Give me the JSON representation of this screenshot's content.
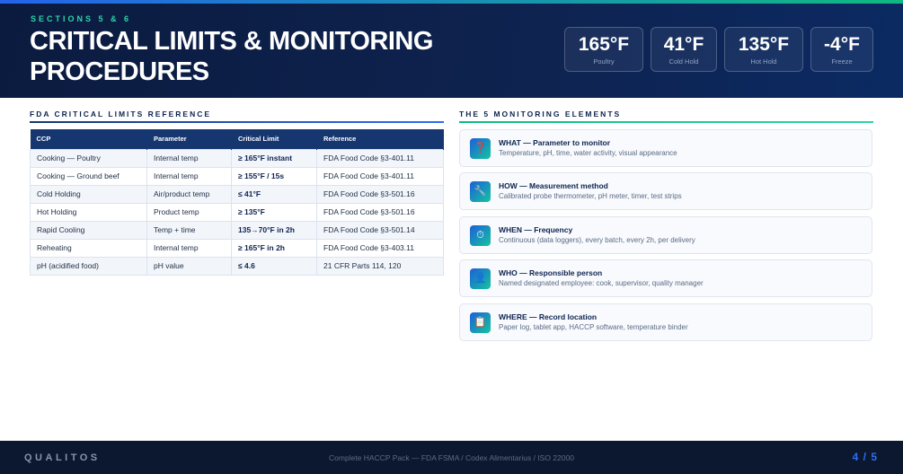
{
  "header": {
    "eyebrow": "SECTIONS 5 & 6",
    "title": "CRITICAL LIMITS & MONITORING PROCEDURES",
    "stats": [
      {
        "value": "165°F",
        "label": "Poultry"
      },
      {
        "value": "41°F",
        "label": "Cold Hold"
      },
      {
        "value": "135°F",
        "label": "Hot Hold"
      },
      {
        "value": "-4°F",
        "label": "Freeze"
      }
    ]
  },
  "limits_section": {
    "title": "FDA CRITICAL LIMITS REFERENCE",
    "columns": [
      "CCP",
      "Parameter",
      "Critical Limit",
      "Reference"
    ],
    "rows": [
      [
        "Cooking — Poultry",
        "Internal temp",
        "≥ 165°F instant",
        "FDA Food Code §3-401.11"
      ],
      [
        "Cooking — Ground beef",
        "Internal temp",
        "≥ 155°F / 15s",
        "FDA Food Code §3-401.11"
      ],
      [
        "Cold Holding",
        "Air/product temp",
        "≤ 41°F",
        "FDA Food Code §3-501.16"
      ],
      [
        "Hot Holding",
        "Product temp",
        "≥ 135°F",
        "FDA Food Code §3-501.16"
      ],
      [
        "Rapid Cooling",
        "Temp + time",
        "135→70°F in 2h",
        "FDA Food Code §3-501.14"
      ],
      [
        "Reheating",
        "Internal temp",
        "≥ 165°F in 2h",
        "FDA Food Code §3-403.11"
      ],
      [
        "pH (acidified food)",
        "pH value",
        "≤ 4.6",
        "21 CFR Parts 114, 120"
      ]
    ]
  },
  "monitoring_section": {
    "title": "THE 5 MONITORING ELEMENTS",
    "items": [
      {
        "icon": "❓",
        "icon_name": "question-icon",
        "title": "WHAT — Parameter to monitor",
        "desc": "Temperature, pH, time, water activity, visual appearance"
      },
      {
        "icon": "🔧",
        "icon_name": "wrench-icon",
        "title": "HOW — Measurement method",
        "desc": "Calibrated probe thermometer, pH meter, timer, test strips"
      },
      {
        "icon": "⏱",
        "icon_name": "timer-icon",
        "title": "WHEN — Frequency",
        "desc": "Continuous (data loggers), every batch, every 2h, per delivery"
      },
      {
        "icon": "👤",
        "icon_name": "person-icon",
        "title": "WHO — Responsible person",
        "desc": "Named designated employee: cook, supervisor, quality manager"
      },
      {
        "icon": "📋",
        "icon_name": "clipboard-icon",
        "title": "WHERE — Record location",
        "desc": "Paper log, tablet app, HACCP software, temperature binder"
      }
    ]
  },
  "footer": {
    "brand": "QUALITOS",
    "text": "Complete HACCP Pack — FDA FSMA / Codex Alimentarius / ISO 22000",
    "page": "4 / 5"
  },
  "colors": {
    "header_bg": "#0e2350",
    "accent_green": "#2dd4a8",
    "accent_blue": "#2f6df0",
    "table_header": "#163670"
  }
}
